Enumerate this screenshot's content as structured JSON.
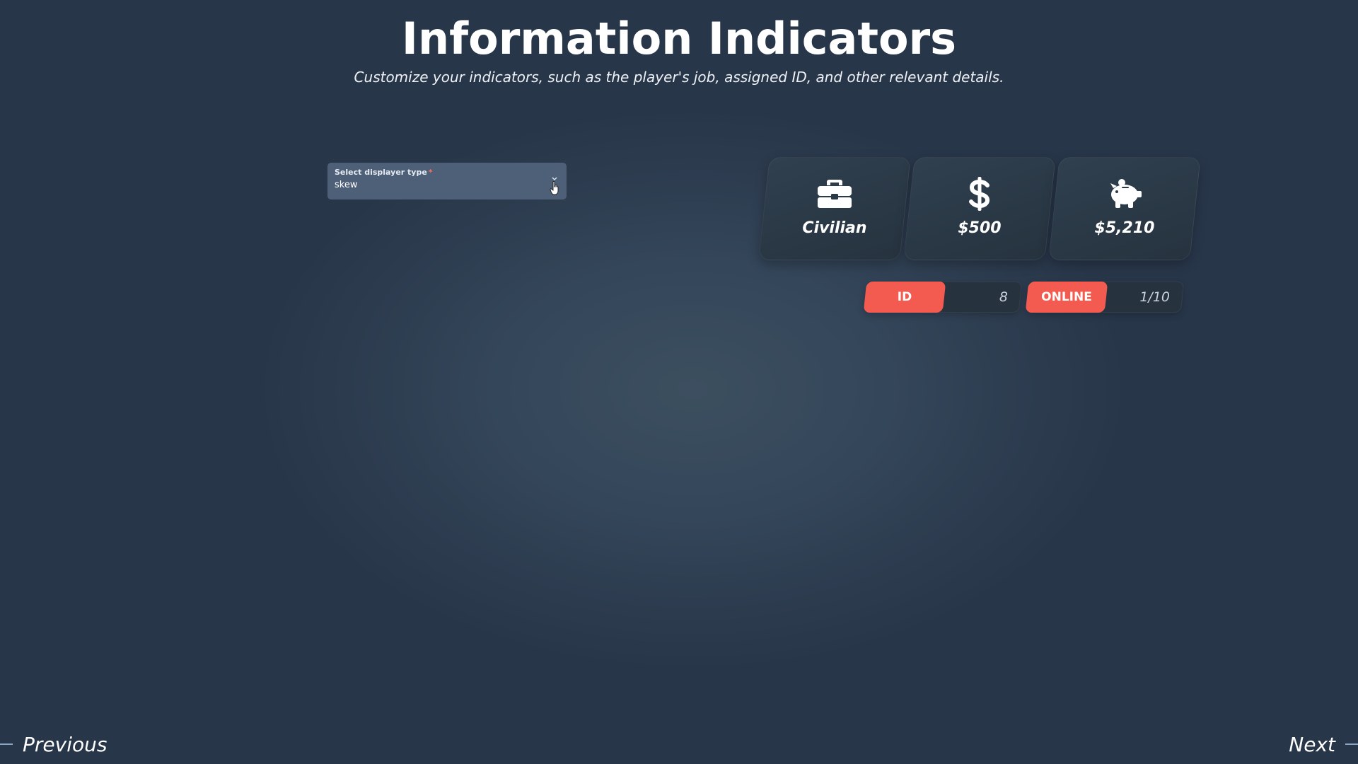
{
  "header": {
    "title": "Information Indicators",
    "subtitle": "Customize your indicators, such as the player's job, assigned ID, and other relevant details."
  },
  "displayer_select": {
    "label": "Select displayer type",
    "required_mark": "*",
    "value": "skew"
  },
  "cards": [
    {
      "icon": "briefcase-icon",
      "text": "Civilian"
    },
    {
      "icon": "dollar-icon",
      "text": "$500"
    },
    {
      "icon": "piggy-bank-icon",
      "text": "$5,210"
    }
  ],
  "pills": [
    {
      "tag": "ID",
      "value": "8"
    },
    {
      "tag": "ONLINE",
      "value": "1/10"
    }
  ],
  "navigation": {
    "previous": "Previous",
    "next": "Next"
  },
  "colors": {
    "accent": "#f45b50",
    "card_bg": "#2b3947",
    "select_bg": "#4e5f78"
  }
}
